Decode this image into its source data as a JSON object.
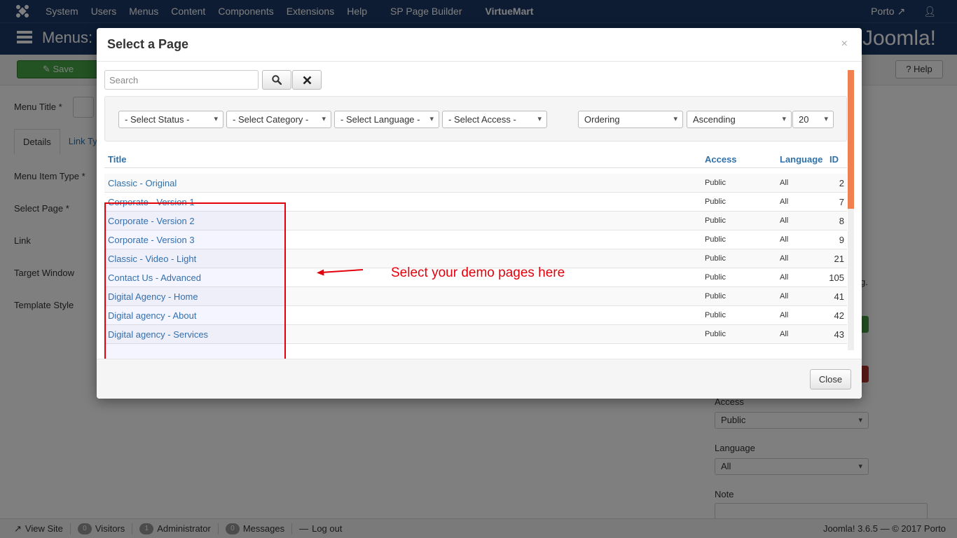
{
  "topnav": {
    "items": [
      "System",
      "Users",
      "Menus",
      "Content",
      "Components",
      "Extensions",
      "Help",
      "SP Page Builder",
      "VirtueMart"
    ],
    "site_name": "Porto"
  },
  "titlebar": {
    "title": "Menus: E",
    "brand": "Joomla!"
  },
  "toolbar": {
    "save_label": "Save",
    "help_label": "Help"
  },
  "background": {
    "menu_title_label": "Menu Title *",
    "tabs": [
      "Details",
      "Link Ty"
    ],
    "fields": [
      "Menu Item Type *",
      "Select Page *",
      "Link",
      "Target Window",
      "Template Style"
    ],
    "access_label": "Access",
    "access_value": "Public",
    "language_label": "Language",
    "language_value": "All",
    "note_label": "Note",
    "trailing_text": "g."
  },
  "statusbar": {
    "view_site": "View Site",
    "visitors_count": "0",
    "visitors_label": "Visitors",
    "admin_count": "1",
    "admin_label": "Administrator",
    "messages_count": "0",
    "messages_label": "Messages",
    "logout_label": "Log out",
    "copyright": "Joomla! 3.6.5 — © 2017 Porto"
  },
  "modal": {
    "title": "Select a Page",
    "close_x": "×",
    "search_placeholder": "Search",
    "filters": {
      "status": "- Select Status -",
      "category": "- Select Category -",
      "language": "- Select Language -",
      "access": "- Select Access -",
      "ordering": "Ordering",
      "direction": "Ascending",
      "limit": "20"
    },
    "columns": {
      "title": "Title",
      "access": "Access",
      "language": "Language",
      "id": "ID"
    },
    "rows": [
      {
        "title": "Classic - Original",
        "access": "Public",
        "language": "All",
        "id": "2"
      },
      {
        "title": "Corporate - Version 1",
        "access": "Public",
        "language": "All",
        "id": "7"
      },
      {
        "title": "Corporate - Version 2",
        "access": "Public",
        "language": "All",
        "id": "8"
      },
      {
        "title": "Corporate - Version 3",
        "access": "Public",
        "language": "All",
        "id": "9"
      },
      {
        "title": "Classic - Video - Light",
        "access": "Public",
        "language": "All",
        "id": "21"
      },
      {
        "title": "Contact Us - Advanced",
        "access": "Public",
        "language": "All",
        "id": "105"
      },
      {
        "title": "Digital Agency - Home",
        "access": "Public",
        "language": "All",
        "id": "41"
      },
      {
        "title": "Digital agency - About",
        "access": "Public",
        "language": "All",
        "id": "42"
      },
      {
        "title": "Digital agency - Services",
        "access": "Public",
        "language": "All",
        "id": "43"
      }
    ],
    "annotation": "Select your demo pages here",
    "close_button": "Close"
  },
  "colors": {
    "navbar": "#1a3867",
    "link": "#3071a9",
    "annotation": "#e3000b",
    "scrollbar": "#f08050"
  }
}
